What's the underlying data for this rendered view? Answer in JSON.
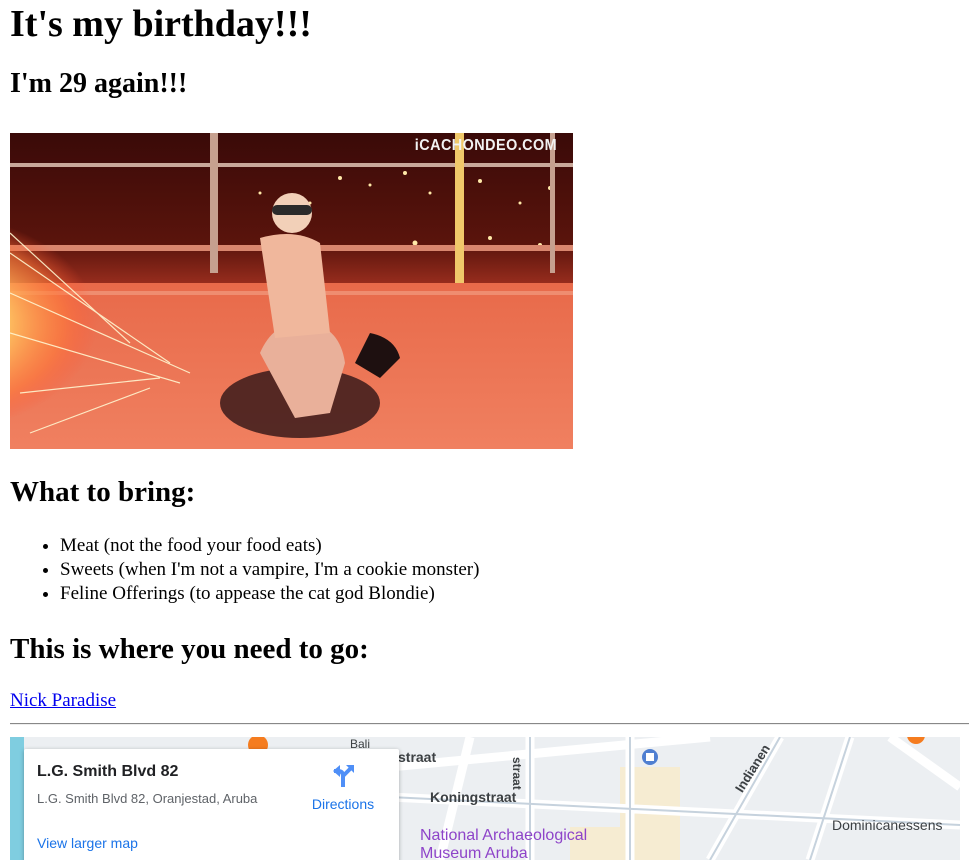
{
  "header": {
    "title": "It's my birthday!!!",
    "subtitle": "I'm 29 again!!!"
  },
  "hero": {
    "watermark": "iCACHONDEO.COM"
  },
  "bring": {
    "title": "What to bring:",
    "items": [
      "Meat (not the food your food eats)",
      "Sweets (when I'm not a vampire, I'm a cookie monster)",
      "Feline Offerings (to appease the cat god Blondie)"
    ]
  },
  "location": {
    "title": "This is where you need to go:",
    "link_text": "Nick Paradise"
  },
  "map": {
    "card": {
      "title": "L.G. Smith Blvd 82",
      "address": "L.G. Smith Blvd 82, Oranjestad, Aruba",
      "directions_label": "Directions",
      "view_larger_label": "View larger map"
    },
    "labels": {
      "koningstraat": "Koningstraat",
      "museum_line1": "National Archaeological",
      "museum_line2": "Museum Aruba",
      "dominicanessen": "Dominicanessens",
      "indianen": "Indianen",
      "straat_top": "straat",
      "straat_vertical": "straat",
      "bali": "Bali"
    },
    "colors": {
      "museum": "#8e44c9",
      "link_blue": "#1a73e8",
      "poi_orange": "#f57c1f"
    }
  }
}
